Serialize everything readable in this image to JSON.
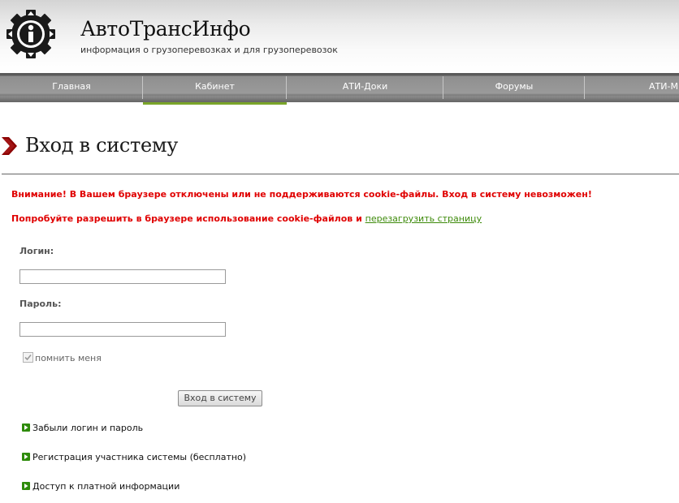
{
  "header": {
    "title": "АвтоТрансИнфо",
    "subtitle": "информация о грузоперевозках и для грузоперевозок",
    "logo_icon": "ati-gear-logo-icon"
  },
  "nav": {
    "items": [
      {
        "label": "Главная",
        "active": false
      },
      {
        "label": "Кабинет",
        "active": true
      },
      {
        "label": "АТИ-Доки",
        "active": false
      },
      {
        "label": "Форумы",
        "active": false
      },
      {
        "label": "АТИ-М",
        "active": false
      }
    ],
    "active_color": "#7aa529"
  },
  "page": {
    "title": "Вход в систему"
  },
  "alerts": {
    "cookie_error": "Внимание! В Вашем браузере отключены или не поддерживаются cookie-файлы. Вход в систему невозможен!",
    "cookie_hint": "Попробуйте разрешить в браузере использование cookie-файлов и",
    "reload_link": "перезагрузить страницу",
    "error_color": "#e00000"
  },
  "form": {
    "login_label": "Логин:",
    "login_value": "",
    "password_label": "Пароль:",
    "password_value": "",
    "remember_label": "помнить меня",
    "remember_checked": true,
    "submit_label": "Вход в систему"
  },
  "links": [
    {
      "label": "Забыли логин и пароль",
      "icon": "green-arrow-bullet-icon"
    },
    {
      "label": "Регистрация участника системы (бесплатно)",
      "icon": "green-arrow-bullet-icon"
    },
    {
      "label": "Доступ к платной информации",
      "icon": "green-arrow-bullet-icon"
    }
  ]
}
